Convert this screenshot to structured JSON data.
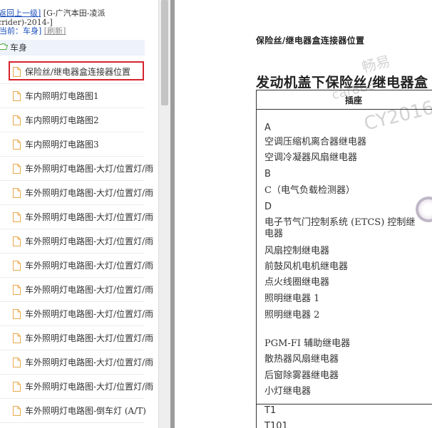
{
  "breadcrumb": {
    "back_link": "返回上一级]",
    "vehicle": "[G-广汽本田-凌派",
    "model_tail": "crider)-2014-]",
    "current_prefix": "当前：",
    "current": "车身]",
    "refresh": "[刷新]"
  },
  "tree": {
    "root_label": "车身",
    "items": [
      {
        "label": "保险丝/继电器盒连接器位置",
        "selected": true
      },
      {
        "label": "车内照明灯电路图1"
      },
      {
        "label": "车内照明灯电路图2"
      },
      {
        "label": "车内照明灯电路图3"
      },
      {
        "label": "车外照明灯电路图-大灯/位置灯/雨"
      },
      {
        "label": "车外照明灯电路图-大灯/位置灯/雨"
      },
      {
        "label": "车外照明灯电路图-大灯/位置灯/雨"
      },
      {
        "label": "车外照明灯电路图-大灯/位置灯/雨"
      },
      {
        "label": "车外照明灯电路图-大灯/位置灯/雨"
      },
      {
        "label": "车外照明灯电路图-大灯/位置灯/雨"
      },
      {
        "label": "车外照明灯电路图-大灯/位置灯/雨"
      },
      {
        "label": "车外照明灯电路图-大灯/位置灯/雨"
      },
      {
        "label": "车外照明灯电路图-大灯/位置灯/雨"
      },
      {
        "label": "车外照明灯电路图-大灯/位置灯/雨"
      },
      {
        "label": "车外照明灯电路图-倒车灯 (A/T)"
      }
    ]
  },
  "document": {
    "subtitle": "保险丝/继电器盒连接器位置",
    "title": "发动机盖下保险丝/继电器盒",
    "watermark": [
      "畅易",
      "car888",
      "CY2016"
    ],
    "table_header": "插座",
    "rows": [
      "A",
      "空调压缩机离合器继电器",
      "空调冷凝器风扇继电器",
      "B",
      "C（电气负载检测器）",
      "D",
      "电子节气门控制系统 (ETCS) 控制继",
      "电器",
      "风扇控制继电器",
      "前鼓风机电机继电器",
      "点火线圈继电器",
      "照明继电器 1",
      "照明继电器 2",
      "",
      "PGM-FI 辅助继电器",
      "散热器风扇继电器",
      "后窗除雾器继电器",
      "小灯继电器",
      "T1",
      "T101"
    ]
  },
  "colors": {
    "selection_border": "#d5232d",
    "link": "#1a4dbb",
    "root_bg": "#eef2fb"
  }
}
